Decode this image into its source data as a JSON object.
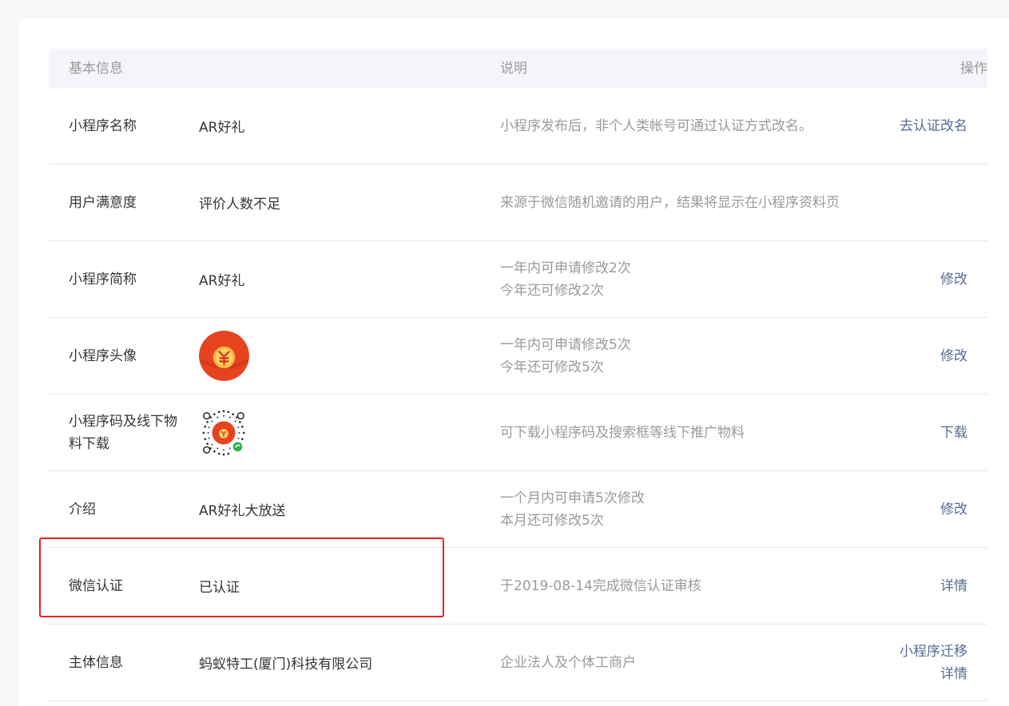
{
  "header": {
    "basic_info": "基本信息",
    "description": "说明",
    "operation": "操作"
  },
  "rows": [
    {
      "label": "小程序名称",
      "value": "AR好礼",
      "desc": [
        "小程序发布后，非个人类帐号可通过认证方式改名。"
      ],
      "ops": [
        "去认证改名"
      ]
    },
    {
      "label": "用户满意度",
      "value": "评价人数不足",
      "desc": [
        "来源于微信随机邀请的用户，结果将显示在小程序资料页"
      ],
      "ops": []
    },
    {
      "label": "小程序简称",
      "value": "AR好礼",
      "desc": [
        "一年内可申请修改2次",
        "今年还可修改2次"
      ],
      "ops": [
        "修改"
      ]
    },
    {
      "label": "小程序头像",
      "value": "",
      "desc": [
        "一年内可申请修改5次",
        "今年还可修改5次"
      ],
      "ops": [
        "修改"
      ]
    },
    {
      "label": "小程序码及线下物料下载",
      "value": "",
      "desc": [
        "可下载小程序码及搜索框等线下推广物料"
      ],
      "ops": [
        "下载"
      ]
    },
    {
      "label": "介绍",
      "value": "AR好礼大放送",
      "desc": [
        "一个月内可申请5次修改",
        "本月还可修改5次"
      ],
      "ops": [
        "修改"
      ]
    },
    {
      "label": "微信认证",
      "value": "已认证",
      "desc": [
        "于2019-08-14完成微信认证审核"
      ],
      "ops": [
        "详情"
      ]
    },
    {
      "label": "主体信息",
      "value": "蚂蚁特工(厦门)科技有限公司",
      "desc": [
        "企业法人及个体工商户"
      ],
      "ops": [
        "小程序迁移",
        "详情"
      ]
    }
  ],
  "colors": {
    "link": "#576b95",
    "highlight_border": "#e8211f",
    "avatar_red": "#e8431f"
  },
  "icons": {
    "avatar": "red-envelope-yuan-icon",
    "qr": "mini-program-code-icon"
  }
}
